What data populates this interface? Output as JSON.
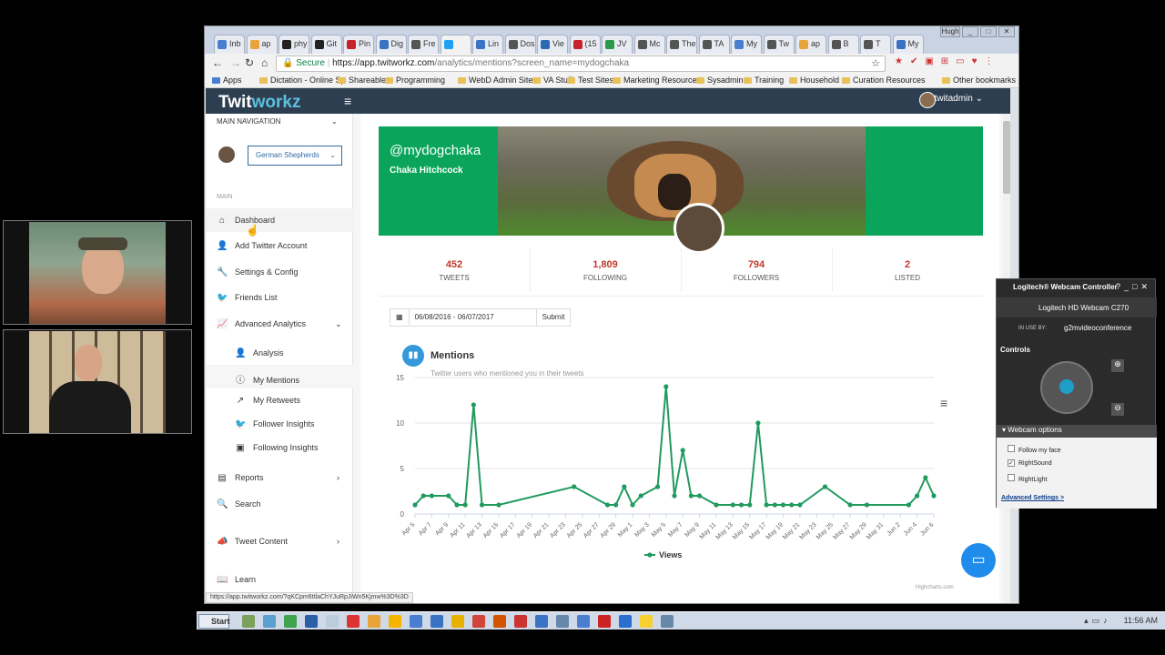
{
  "browser": {
    "tabs": [
      "Inb",
      "ap",
      "phy",
      "Git",
      "Pin",
      "Dig",
      "Fre",
      "",
      "Lin",
      "Dos",
      "Vie",
      "(15",
      "JV",
      "Mc",
      "The",
      "TA",
      "My",
      "Tw",
      "ap",
      "B",
      "T",
      "My"
    ],
    "profile_label": "Hugh",
    "secure_label": "Secure",
    "url_host": "https://app.twitworkz.com",
    "url_path": "/analytics/mentions?screen_name=mydogchaka",
    "bookmarks": [
      "Apps",
      "Dictation - Online Sp",
      "Shareable",
      "Programming",
      "WebD Admin Sites",
      "VA Stuff",
      "Test Sites",
      "Marketing Resources",
      "Sysadmin",
      "Training",
      "Household",
      "Curation Resources"
    ],
    "other_bookmarks": "Other bookmarks",
    "status_url": "https://app.twitworkz.com/?qKCpm6ttlaChYJuRpJiWn5Kjmw%3D%3D"
  },
  "app": {
    "logo_a": "Twit",
    "logo_b": "workz",
    "username": "twitadmin",
    "main_navigation": "MAIN NAVIGATION",
    "account_select": "German Shepherds",
    "section_main": "MAIN",
    "nav": {
      "dashboard": "Dashboard",
      "add_account": "Add Twitter Account",
      "settings": "Settings & Config",
      "friends": "Friends List",
      "advanced": "Advanced Analytics",
      "analysis": "Analysis",
      "mentions": "My Mentions",
      "retweets": "My Retweets",
      "follower_insights": "Follower Insights",
      "following_insights": "Following Insights",
      "reports": "Reports",
      "search": "Search",
      "tweet_content": "Tweet Content",
      "learn": "Learn"
    }
  },
  "profile": {
    "handle": "@mydogchaka",
    "name": "Chaka Hitchcock",
    "stats": [
      {
        "value": "452",
        "label": "TWEETS"
      },
      {
        "value": "1,809",
        "label": "FOLLOWING"
      },
      {
        "value": "794",
        "label": "FOLLOWERS"
      },
      {
        "value": "2",
        "label": "LISTED"
      }
    ]
  },
  "filter": {
    "date_range": "06/08/2016 - 06/07/2017",
    "submit": "Submit"
  },
  "mentions_card": {
    "title": "Mentions",
    "subtitle": "Twitter users who mentioned you in their tweets",
    "credit": "Highcharts.com"
  },
  "chart_data": {
    "type": "line",
    "title": "",
    "xlabel": "",
    "ylabel": "",
    "ylim": [
      0,
      15
    ],
    "yticks": [
      0,
      5,
      10,
      15
    ],
    "tick_labels": [
      "Apr 5",
      "Apr 7",
      "Apr 9",
      "Apr 11",
      "Apr 13",
      "Apr 15",
      "Apr 17",
      "Apr 19",
      "Apr 21",
      "Apr 23",
      "Apr 25",
      "Apr 27",
      "Apr 29",
      "May 1",
      "May 3",
      "May 5",
      "May 7",
      "May 9",
      "May 11",
      "May 13",
      "May 15",
      "May 17",
      "May 19",
      "May 21",
      "May 23",
      "May 25",
      "May 27",
      "May 29",
      "May 31",
      "Jun 2",
      "Jun 4",
      "Jun 6"
    ],
    "series": [
      {
        "name": "Views",
        "color": "#219a5e",
        "points": [
          [
            "Apr 5",
            1
          ],
          [
            "Apr 6",
            2
          ],
          [
            "Apr 7",
            2
          ],
          [
            "Apr 9",
            2
          ],
          [
            "Apr 10",
            1
          ],
          [
            "Apr 11",
            1
          ],
          [
            "Apr 12",
            12
          ],
          [
            "Apr 13",
            1
          ],
          [
            "Apr 15",
            1
          ],
          [
            "Apr 24",
            3
          ],
          [
            "Apr 28",
            1
          ],
          [
            "Apr 29",
            1
          ],
          [
            "Apr 30",
            3
          ],
          [
            "May 1",
            1
          ],
          [
            "May 2",
            2
          ],
          [
            "May 4",
            3
          ],
          [
            "May 5",
            14
          ],
          [
            "May 6",
            2
          ],
          [
            "May 7",
            7
          ],
          [
            "May 8",
            2
          ],
          [
            "May 9",
            2
          ],
          [
            "May 11",
            1
          ],
          [
            "May 13",
            1
          ],
          [
            "May 14",
            1
          ],
          [
            "May 15",
            1
          ],
          [
            "May 16",
            10
          ],
          [
            "May 17",
            1
          ],
          [
            "May 18",
            1
          ],
          [
            "May 19",
            1
          ],
          [
            "May 20",
            1
          ],
          [
            "May 21",
            1
          ],
          [
            "May 24",
            3
          ],
          [
            "May 27",
            1
          ],
          [
            "May 29",
            1
          ],
          [
            "Jun 3",
            1
          ],
          [
            "Jun 4",
            2
          ],
          [
            "Jun 5",
            4
          ],
          [
            "Jun 6",
            2
          ]
        ]
      }
    ]
  },
  "webcam": {
    "title": "Logitech® Webcam Controller",
    "device": "Logitech HD Webcam C270",
    "in_use_label": "IN USE BY:",
    "in_use_app": "g2mvideoconference",
    "controls": "Controls",
    "options_header": "Webcam options",
    "options": [
      {
        "label": "Follow my face",
        "checked": false
      },
      {
        "label": "RightSound",
        "checked": true
      },
      {
        "label": "RightLight",
        "checked": false
      }
    ],
    "advanced": "Advanced Settings >"
  },
  "taskbar": {
    "start": "Start",
    "time": "11:56 AM"
  }
}
